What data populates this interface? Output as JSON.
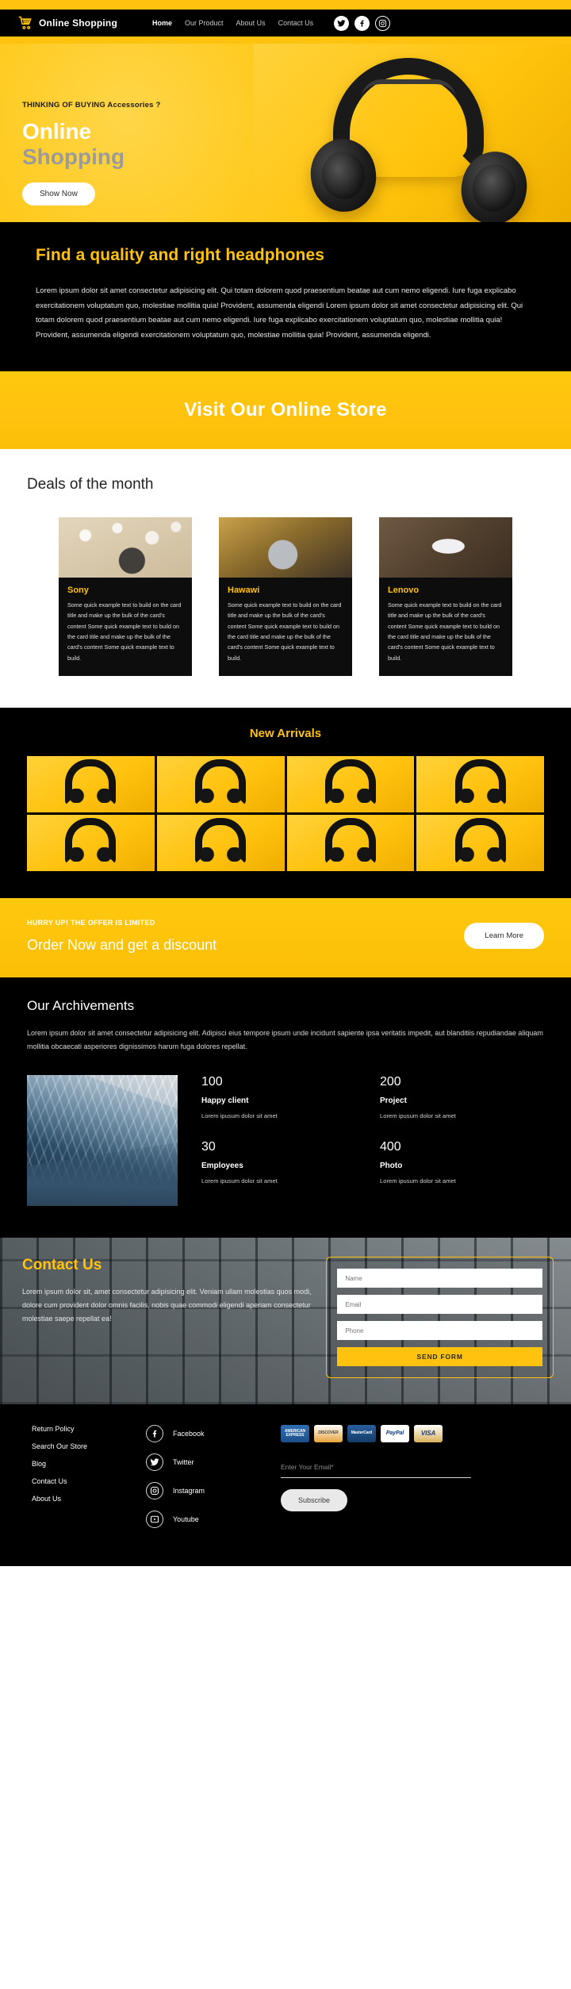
{
  "navbar": {
    "brand": "Online Shopping",
    "cart_icon": "shopping-cart-icon",
    "links": [
      {
        "label": "Home",
        "active": true
      },
      {
        "label": "Our Product",
        "active": false
      },
      {
        "label": "About Us",
        "active": false
      },
      {
        "label": "Contact Us",
        "active": false
      }
    ],
    "social": [
      {
        "name": "twitter-icon",
        "style": "filled"
      },
      {
        "name": "facebook-icon",
        "style": "filled"
      },
      {
        "name": "instagram-icon",
        "style": "ring"
      }
    ]
  },
  "hero": {
    "kicker": "THINKING OF BUYING Accessories ?",
    "title_line1": "Online",
    "title_line2": "Shopping",
    "cta": "Show Now",
    "bg_color": "#FFC20E",
    "title1_color": "#FFFFFF",
    "title2_color": "#9B9B9B"
  },
  "intro": {
    "title": "Find a quality and right headphones",
    "body": "Lorem ipsum dolor sit amet consectetur adipisicing elit. Qui totam dolorem quod praesentium beatae aut cum nemo eligendi. Iure fuga explicabo exercitationem voluptatum quo, molestiae mollitia quia! Provident, assumenda eligendi Lorem ipsum dolor sit amet consectetur adipisicing elit. Qui totam dolorem quod praesentium beatae aut cum nemo eligendi. Iure fuga explicabo exercitationem voluptatum quo, molestiae mollitia quia! Provident, assumenda eligendi exercitationem voluptatum quo, molestiae mollitia quia! Provident, assumenda eligendi.",
    "title_color": "#FFC20E"
  },
  "visit_banner": {
    "text": "Visit Our Online Store"
  },
  "deals": {
    "title": "Deals of the month",
    "cards": [
      {
        "title": "Sony",
        "text": "Some quick example text to build on the card title and make up the bulk of the card's content Some quick example text to build on the card title and make up the bulk of the card's content Some quick example text to build."
      },
      {
        "title": "Hawawi",
        "text": "Some quick example text to build on the card title and make up the bulk of the card's content Some quick example text to build on the card title and make up the bulk of the card's content Some quick example text to build."
      },
      {
        "title": "Lenovo",
        "text": "Some quick example text to build on the card title and make up the bulk of the card's content Some quick example text to build on the card title and make up the bulk of the card's content Some quick example text to build."
      }
    ]
  },
  "arrivals": {
    "title": "New Arrivals",
    "tile_count": 8
  },
  "offer": {
    "kicker": "HURRY UP! THE OFFER IS LIMITED",
    "title": "Order Now and get a discount",
    "cta": "Learn More"
  },
  "achievements": {
    "title": "Our Archivements",
    "body": "Lorem ipsum dolor sit amet consectetur adipisicing elit. Adipisci eius tempore ipsum unde incidunt sapiente ipsa veritatis impedit, aut blanditiis repudiandae aliquam mollitia obcaecati asperiores dignissimos harum fuga dolores repellat.",
    "stats": [
      {
        "number": "100",
        "label": "Happy client",
        "sub": "Lorem ipusum dolor sit amet"
      },
      {
        "number": "200",
        "label": "Project",
        "sub": "Lorem ipusum dolor sit amet"
      },
      {
        "number": "30",
        "label": "Employees",
        "sub": "Lorem ipusum dolor sit amet"
      },
      {
        "number": "400",
        "label": "Photo",
        "sub": "Lorem ipusum dolor sit amet"
      }
    ]
  },
  "contact": {
    "title": "Contact Us",
    "body": "Lorem ipsum dolor sit, amet consectetur adipisicing elit. Veniam ullam molestias quos modi, dolore cum provident dolor omnis facilis, nobis quae commodi eligendi aperiam consectetur molestiae saepe repellat ea!",
    "fields": [
      {
        "placeholder": "Name",
        "value": ""
      },
      {
        "placeholder": "Email",
        "value": ""
      },
      {
        "placeholder": "Phone",
        "value": ""
      }
    ],
    "submit": "SEND FORM",
    "accent": "#FFC20E"
  },
  "footer": {
    "links": [
      "Return Policy",
      "Search Our Store",
      "Blog",
      "Contact Us",
      "About Us"
    ],
    "social": [
      {
        "label": "Facebook",
        "icon": "facebook-icon"
      },
      {
        "label": "Twitter",
        "icon": "twitter-icon"
      },
      {
        "label": "Instagram",
        "icon": "instagram-icon"
      },
      {
        "label": "Youtube",
        "icon": "youtube-icon"
      }
    ],
    "payments": [
      {
        "name": "american-express-card",
        "text": "AMERICAN EXPRESS"
      },
      {
        "name": "discover-card",
        "text": "DISCOVER"
      },
      {
        "name": "mastercard-card",
        "text": "MasterCard"
      },
      {
        "name": "paypal-card",
        "text": "PayPal"
      },
      {
        "name": "visa-card",
        "text": "VISA"
      }
    ],
    "newsletter_placeholder": "Enter Your Email*",
    "subscribe": "Subscribe"
  }
}
